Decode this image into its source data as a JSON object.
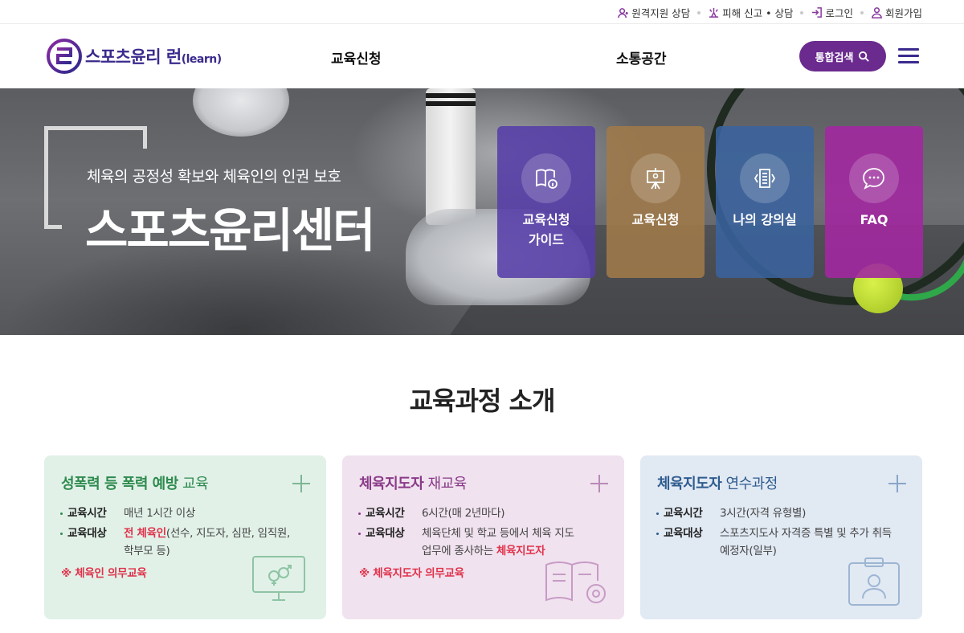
{
  "util_links": [
    {
      "label": "원격지원 상담",
      "icon": "headset-icon"
    },
    {
      "label": "피해 신고 • 상담",
      "icon": "alert-icon"
    },
    {
      "label": "로그인",
      "icon": "login-icon"
    },
    {
      "label": "회원가입",
      "icon": "user-icon"
    }
  ],
  "header": {
    "logo_text": "스포츠윤리 런",
    "logo_en": "(learn)",
    "nav": [
      "교육신청",
      "소통공간"
    ],
    "search_label": "통합검색"
  },
  "hero": {
    "subtitle": "체육의 공정성 확보와 체육인의 인권 보호",
    "title": "스포츠윤리센터",
    "quick_links": [
      {
        "line1": "교육신청",
        "line2": "가이드",
        "icon": "book-info-icon",
        "color": "#563ea8"
      },
      {
        "line1": "교육신청",
        "line2": "",
        "icon": "presentation-icon",
        "color": "#a07a4a"
      },
      {
        "line1": "나의 강의실",
        "line2": "",
        "icon": "classroom-icon",
        "color": "#3a639e"
      },
      {
        "line1": "FAQ",
        "line2": "",
        "icon": "chat-bubble-icon",
        "color": "#a228a0"
      }
    ]
  },
  "section": {
    "title": "교육과정 소개",
    "cards": [
      {
        "title_strong": "성폭력 등 폭력 예방",
        "title_rest": " 교육",
        "time_label": "교육시간",
        "time_value": "매년 1시간 이상",
        "target_label": "교육대상",
        "target_hl": "전 체육인",
        "target_value_1": "(선수, 지도자, 심판, 임직원,",
        "target_value_2": "학부모 등)",
        "note": "※ 체육인 의무교육",
        "icon": "monitor-gender-icon"
      },
      {
        "title_strong": "체육지도자",
        "title_rest": " 재교육",
        "time_label": "교육시간",
        "time_value": "6시간(매 2년마다)",
        "target_label": "교육대상",
        "target_value_1": "체육단체 및 학교 등에서 체육 지도",
        "target_value_2": "업무에 종사하는 ",
        "target_hl": "체육지도자",
        "note": "※ 체육지도자 의무교육",
        "icon": "book-refresh-icon"
      },
      {
        "title_strong": "체육지도자",
        "title_rest": " 연수과정",
        "time_label": "교육시간",
        "time_value": "3시간(자격 유형별)",
        "target_label": "교육대상",
        "target_value_1": "스포츠지도사 자격증 특별 및 추가 취득",
        "target_value_2": "예정자(일부)",
        "icon": "id-badge-icon"
      }
    ]
  }
}
